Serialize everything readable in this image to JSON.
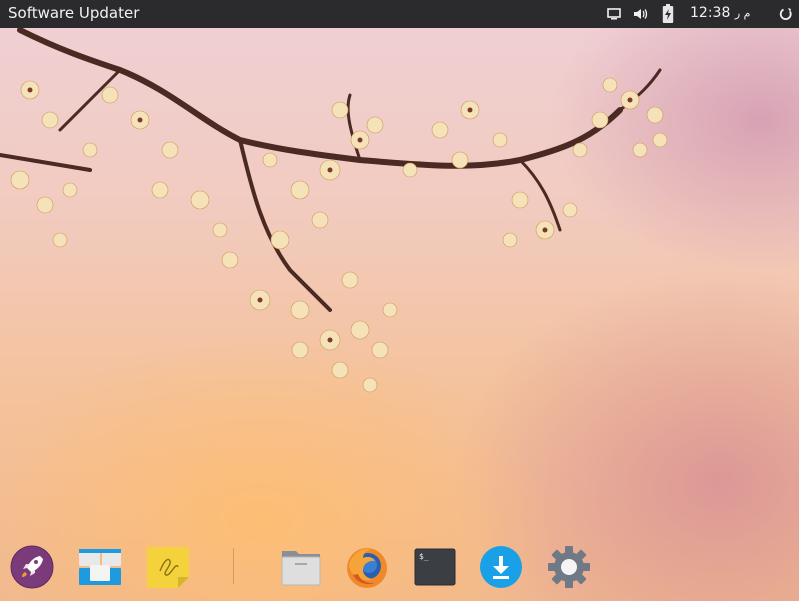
{
  "window": {
    "title": "Software Updater"
  },
  "topbar": {
    "clock_time": "12:38",
    "clock_suffix": "م ر",
    "icons": [
      "display-icon",
      "volume-icon",
      "battery-charging-icon",
      "power-icon"
    ]
  },
  "dock": {
    "items": [
      {
        "name": "launcher",
        "icon": "rocket-icon"
      },
      {
        "name": "multitasking-view",
        "icon": "workspaces-icon"
      },
      {
        "name": "sticky-notes",
        "icon": "sticky-note-icon"
      },
      {
        "name": "files",
        "icon": "folder-icon"
      },
      {
        "name": "firefox",
        "icon": "firefox-icon"
      },
      {
        "name": "terminal",
        "icon": "terminal-icon"
      },
      {
        "name": "software-updater",
        "icon": "download-icon"
      },
      {
        "name": "system-settings",
        "icon": "settings-gear-icon"
      }
    ],
    "terminal_prompt": "$_"
  },
  "colors": {
    "topbar_bg": "#2b2b2e",
    "launcher_purple": "#7b3a7a",
    "download_blue": "#1aa0e6",
    "sticky_yellow": "#f3d23b",
    "folder_gray": "#dcdcdc",
    "terminal_bg": "#3b3f44",
    "gear_gray": "#6f7a86"
  }
}
